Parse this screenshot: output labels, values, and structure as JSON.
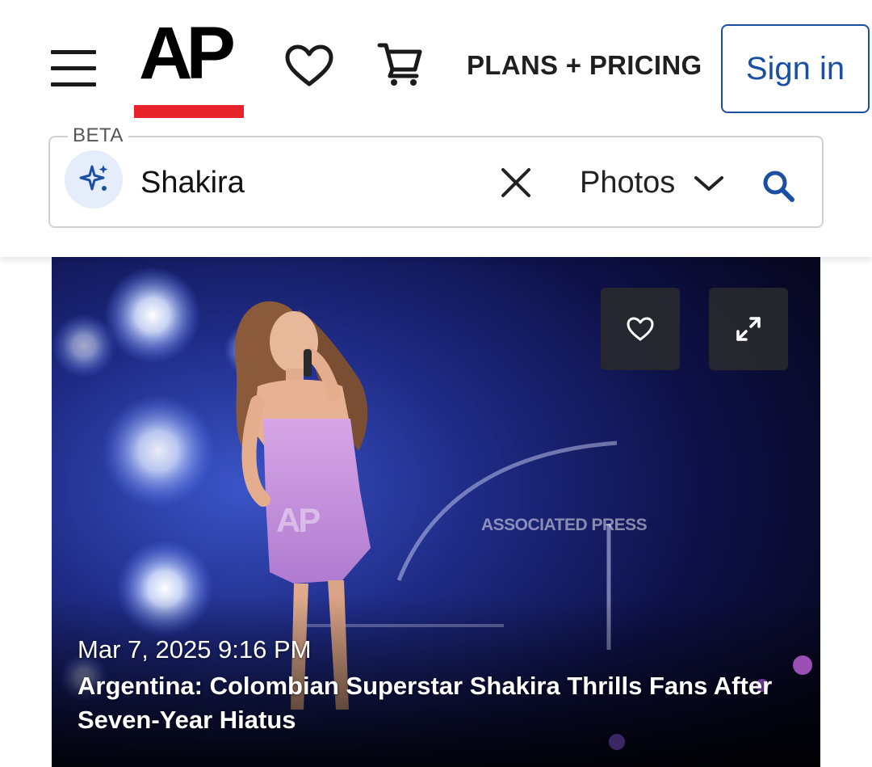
{
  "header": {
    "logo_text": "AP",
    "plans_link": "PLANS + PRICING",
    "signin_label": "Sign in"
  },
  "search": {
    "beta_label": "BETA",
    "query": "Shakira",
    "type_selected": "Photos"
  },
  "result": {
    "date": "Mar 7, 2025 9:16 PM",
    "title": "Argentina: Colombian Superstar Shakira Thrills Fans After Seven-Year Hiatus",
    "watermark_logo": "AP",
    "watermark_text": "ASSOCIATED PRESS"
  },
  "colors": {
    "accent_red": "#e8222b",
    "link_blue": "#1a4fa3",
    "ai_badge_bg": "#e4edf9"
  },
  "icons": [
    "hamburger-menu-icon",
    "heart-icon",
    "cart-icon",
    "sparkle-icon",
    "close-icon",
    "chevron-down-icon",
    "search-icon",
    "expand-icon"
  ]
}
